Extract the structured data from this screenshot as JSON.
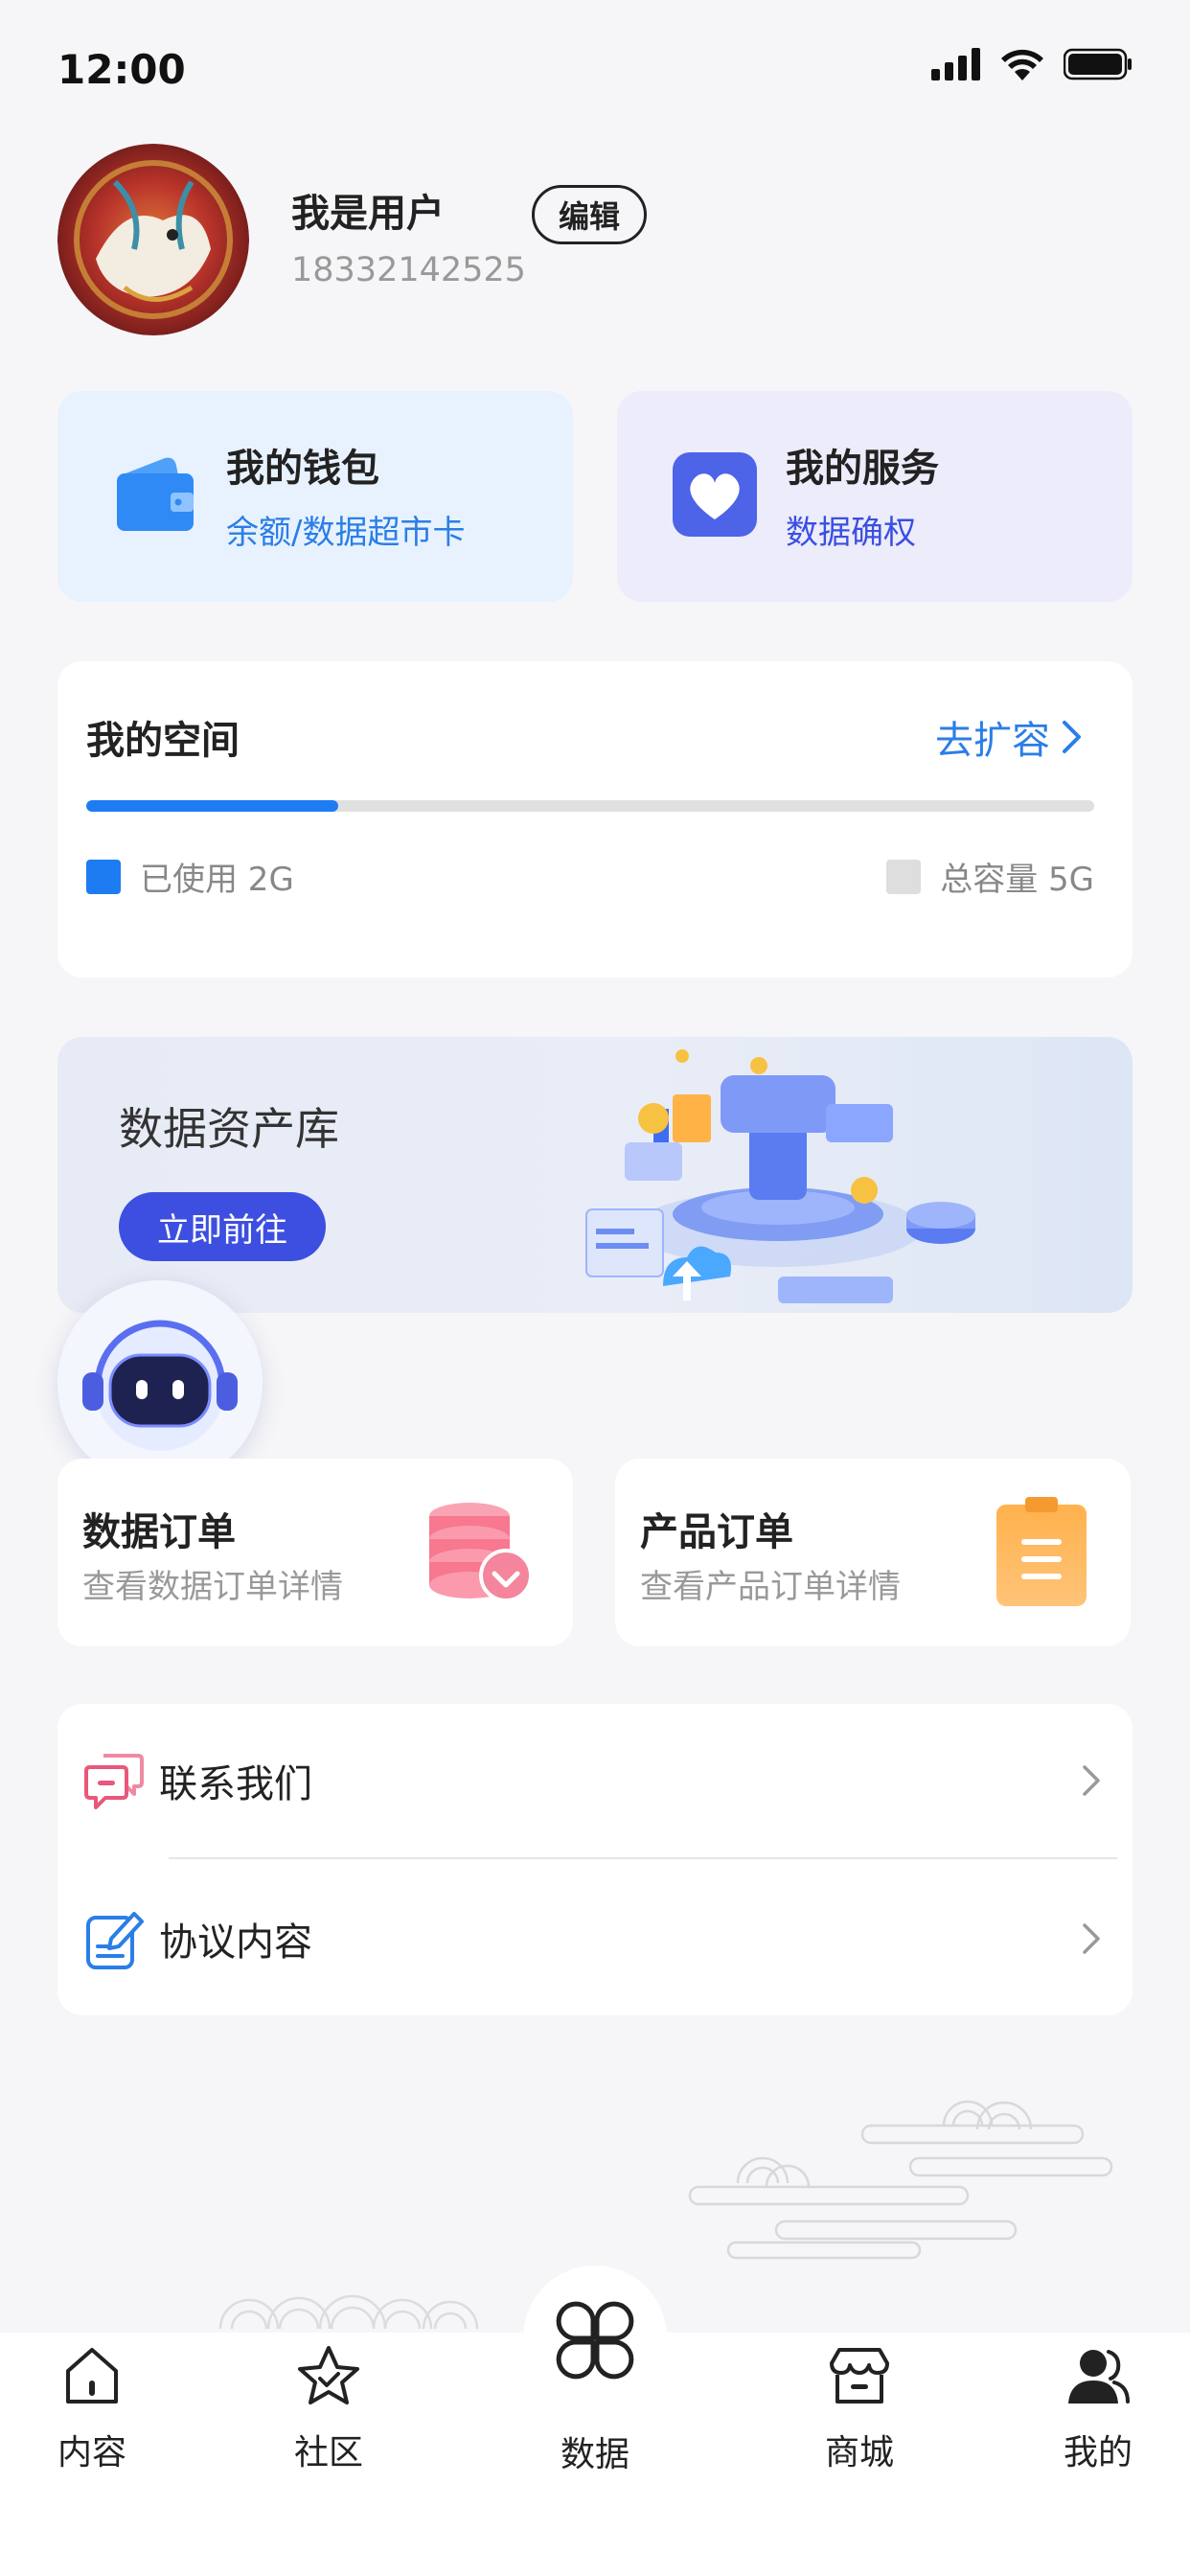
{
  "status_bar": {
    "time": "12:00"
  },
  "profile": {
    "name": "我是用户",
    "phone": "18332142525",
    "edit_label": "编辑"
  },
  "quick_cards": {
    "wallet": {
      "title": "我的钱包",
      "subtitle": "余额/数据超市卡"
    },
    "service": {
      "title": "我的服务",
      "subtitle": "数据确权"
    }
  },
  "space": {
    "title": "我的空间",
    "expand_link": "去扩容",
    "used_fraction": 0.25,
    "used_label": "已使用 2G",
    "total_label": "总容量 5G",
    "used_color": "#1d7cf2",
    "total_color": "#dedede"
  },
  "banner": {
    "title": "数据资产库",
    "button_label": "立即前往"
  },
  "orders": {
    "data_order": {
      "title": "数据订单",
      "subtitle": "查看数据订单详情"
    },
    "product_order": {
      "title": "产品订单",
      "subtitle": "查看产品订单详情"
    }
  },
  "menu": {
    "items": [
      {
        "label": "联系我们",
        "icon": "chat-icon"
      },
      {
        "label": "协议内容",
        "icon": "agreement-icon"
      }
    ]
  },
  "tabbar": {
    "items": [
      {
        "label": "内容",
        "icon": "home-icon"
      },
      {
        "label": "社区",
        "icon": "star-icon"
      },
      {
        "label": "数据",
        "icon": "clover-icon"
      },
      {
        "label": "商城",
        "icon": "store-icon"
      },
      {
        "label": "我的",
        "icon": "user-icon"
      }
    ],
    "active": "我的"
  },
  "colors": {
    "accent_blue": "#2a7ee6",
    "indigo": "#3d4fe0",
    "background": "#f6f6f8"
  }
}
